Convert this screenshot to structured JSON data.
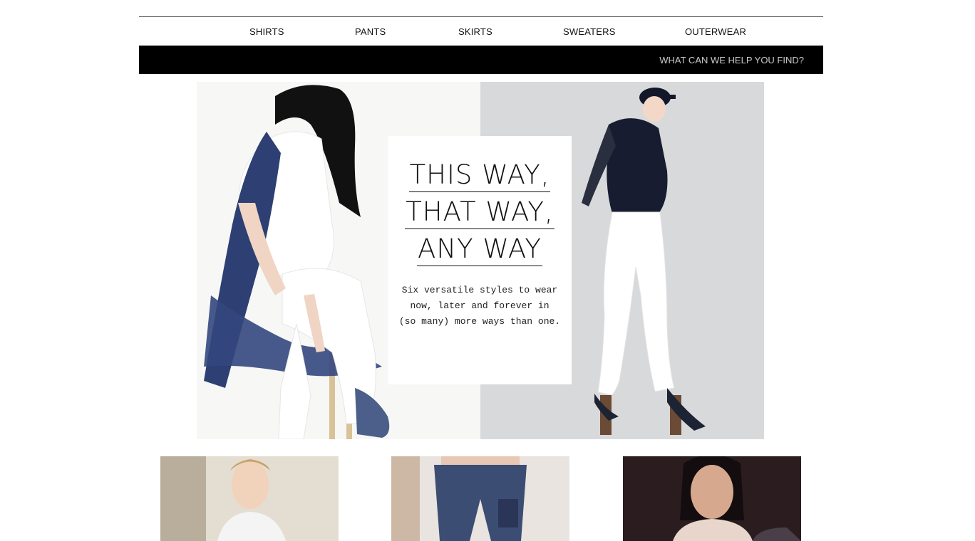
{
  "nav": {
    "items": [
      "SHIRTS",
      "PANTS",
      "SKIRTS",
      "SWEATERS",
      "OUTERWEAR"
    ]
  },
  "search": {
    "placeholder": "WHAT CAN WE HELP YOU FIND?"
  },
  "hero": {
    "headline": [
      "THIS WAY,",
      "THAT WAY,",
      "ANY WAY"
    ],
    "subtext": [
      "Six versatile styles to wear",
      "now, later and forever in",
      "(so many) more ways than one."
    ]
  },
  "colors": {
    "search_bar_bg": "#000000",
    "card_bg": "#ffffff",
    "text": "#111111"
  }
}
